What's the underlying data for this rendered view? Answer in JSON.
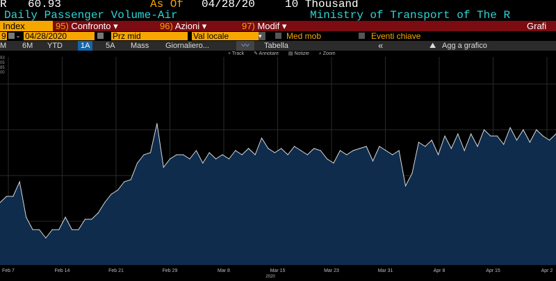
{
  "header": {
    "ticker_fragment": "R",
    "last_value": "60.93",
    "as_of_label": "As Of",
    "as_of_date": "04/28/20",
    "units": "10 Thousand",
    "series_title": "Daily Passenger Volume-Air",
    "source": "Ministry of Transport of The R"
  },
  "function_bar": {
    "index_label": "Index",
    "items": [
      {
        "num": "95)",
        "label": "Confronto"
      },
      {
        "num": "96)",
        "label": "Azioni"
      },
      {
        "num": "97)",
        "label": "Modif"
      }
    ],
    "right_label": "Grafi"
  },
  "controls": {
    "start_date": "9",
    "end_date": "04/28/2020",
    "price_field": "Prz mid",
    "currency_field": "Val locale",
    "mov_avg": "Med mob",
    "events": "Eventi chiave"
  },
  "tabs": {
    "items": [
      "M",
      "6M",
      "YTD",
      "1A",
      "5A",
      "Mass",
      "Giornaliero...",
      "Tabella"
    ],
    "active": "1A",
    "collapse": "«",
    "add_to_chart": "Agg a grafico"
  },
  "toolbar": {
    "items": [
      "Track",
      "Annotare",
      "Notizie",
      "Zoom"
    ]
  },
  "y_ticks_partial": [
    "93",
    "05",
    "85",
    "00"
  ],
  "chart_data": {
    "type": "area",
    "title": "",
    "xlabel": "2020",
    "ylabel": "",
    "x_tick_labels": [
      "Feb 7",
      "Feb 14",
      "Feb 21",
      "Feb 29",
      "Mar 8",
      "Mar 15",
      "Mar 23",
      "Mar 31",
      "Apr 8",
      "Apr 15",
      "Apr 2"
    ],
    "series": [
      {
        "values": [
          30,
          33,
          33,
          40,
          23,
          17,
          17,
          13,
          17,
          17,
          23,
          17,
          17,
          22,
          22,
          25,
          30,
          34,
          36,
          40,
          41,
          49,
          53,
          54,
          68,
          47,
          51,
          53,
          53,
          51,
          55,
          49,
          54,
          51,
          53,
          51,
          55,
          53,
          56,
          53,
          61,
          56,
          54,
          56,
          53,
          57,
          55,
          53,
          56,
          55,
          51,
          49,
          55,
          53,
          55,
          56,
          57,
          50,
          57,
          55,
          53,
          55,
          38,
          44,
          59,
          57,
          60,
          53,
          62,
          56,
          63,
          55,
          63,
          57,
          65,
          62,
          62,
          58,
          66,
          60,
          65,
          59,
          65,
          62,
          60,
          63
        ]
      }
    ],
    "colors": {
      "line": "#d9d9d9",
      "fill": "#0f2c4c"
    }
  }
}
